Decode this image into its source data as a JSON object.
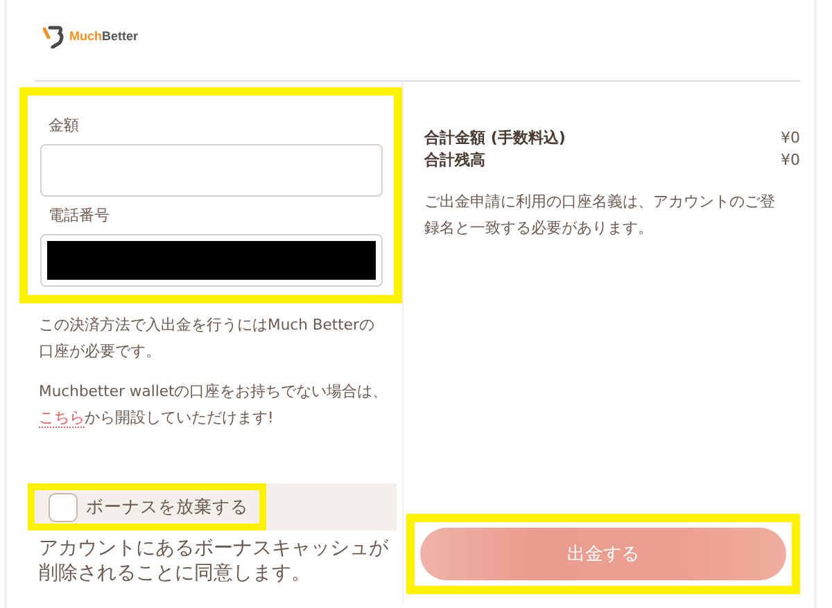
{
  "logo": {
    "part_1": "Much",
    "part_2": "Better"
  },
  "form": {
    "fields": [
      {
        "label": "金額",
        "redacted": false
      },
      {
        "label": "電話番号",
        "redacted": true
      }
    ],
    "highlighted": true,
    "info": [
      "この決済方法で入出金を行うにはMuch Betterの口座が必要です。"
    ],
    "signup": {
      "before": "Muchbetter walletの口座をお持ちでない場合は、",
      "link": "こちら",
      "after": "から開設していただけます!"
    },
    "bonus": {
      "label": "ボーナスを放棄する",
      "checked": false,
      "highlighted": true
    },
    "bonus_note": "アカウントにあるボーナスキャッシュが削除されることに同意します。"
  },
  "summary": {
    "rows": [
      {
        "label": "合計金額 (手数料込)",
        "value": "¥0"
      },
      {
        "label": "合計残高",
        "value": "¥0"
      }
    ],
    "note": "ご出金申請に利用の口座名義は、アカウントのご登録名と一致する必要があります。"
  },
  "submit": {
    "label": "出金する",
    "highlighted": true
  }
}
